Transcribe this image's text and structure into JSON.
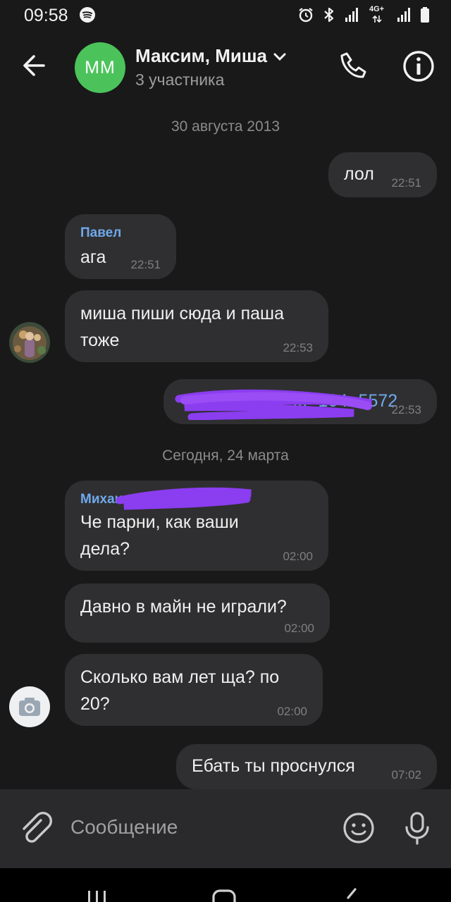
{
  "status_bar": {
    "time": "09:58",
    "network": "4G+"
  },
  "header": {
    "avatar_initials": "MM",
    "title": "Максим, Миша",
    "subtitle": "3 участника"
  },
  "messages": {
    "date_1": "30 августа 2013",
    "m1": {
      "text": "лол",
      "time": "22:51"
    },
    "m2": {
      "sender": "Павел",
      "text": "ага",
      "time": "22:51"
    },
    "m3": {
      "text_line1": "миша пиши сюда и паша",
      "text_line2": "тоже",
      "time": "22:53"
    },
    "m4": {
      "text": "+7 ... ·104 ·5572",
      "time": "22:53"
    },
    "date_2": "Сегодня, 24 марта",
    "m5": {
      "sender": "Михаи",
      "text_line1": "Че парни, как ваши",
      "text_line2": "дела?",
      "time": "02:00"
    },
    "m6": {
      "text": "Давно в майн не играли?",
      "time": "02:00"
    },
    "m7": {
      "text_line1": "Сколько вам лет ща? по",
      "text_line2": "20?",
      "time": "02:00"
    },
    "m8": {
      "text": "Ебать ты проснулся",
      "time": "07:02"
    }
  },
  "composer": {
    "placeholder": "Сообщение"
  },
  "colors": {
    "background": "#19191a",
    "bubble": "#2f2f31",
    "accent_green": "#4bc35a",
    "link_blue": "#6fa9ea",
    "redaction_purple": "#8b3df0"
  },
  "icons": [
    "back-arrow-icon",
    "chevron-down-icon",
    "phone-icon",
    "info-icon",
    "paperclip-icon",
    "emoji-icon",
    "microphone-icon",
    "camera-icon",
    "spotify-icon",
    "alarm-icon",
    "bluetooth-icon",
    "signal-icon",
    "battery-icon"
  ]
}
